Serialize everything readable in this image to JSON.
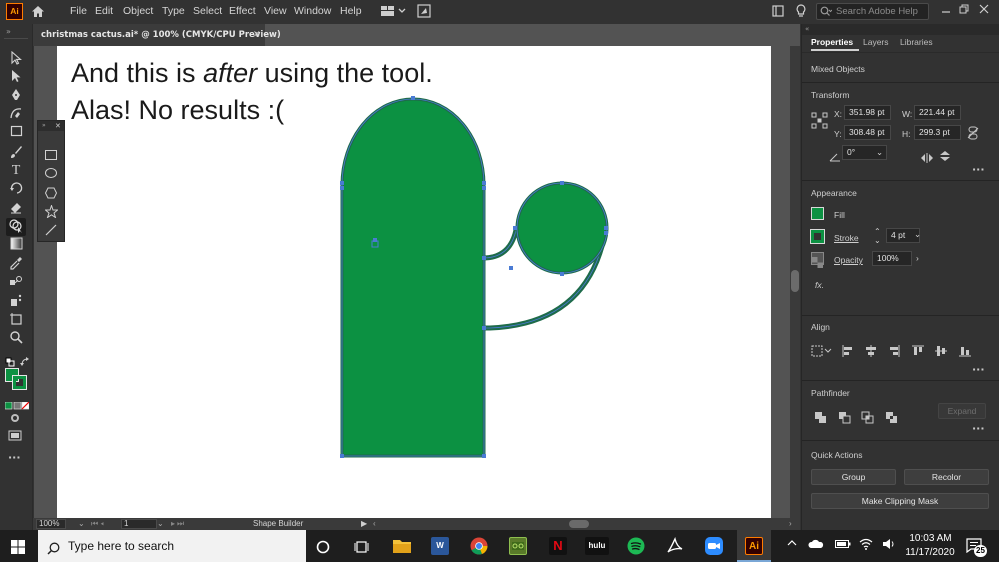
{
  "app": {
    "logo": "Ai",
    "menu": [
      "File",
      "Edit",
      "Object",
      "Type",
      "Select",
      "Effect",
      "View",
      "Window",
      "Help"
    ],
    "search_placeholder": "Search Adobe Help",
    "accent_color": "#ff9a00"
  },
  "document": {
    "tab_title": "christmas cactus.ai* @ 100% (CMYK/CPU Preview)",
    "close_icon": "close-icon"
  },
  "artboard": {
    "line1_pre": "And this is ",
    "line1_em": "after",
    "line1_post": " using the tool.",
    "line2": "Alas! No results :(",
    "fill_color": "#0c9142",
    "stroke_color": "#1e6b4a",
    "selection_color": "#4a7bd4"
  },
  "toolbar": {
    "tools": [
      "selection-tool",
      "direct-selection-tool",
      "pen-tool",
      "curvature-tool",
      "rectangle-tool",
      "paintbrush-tool",
      "type-tool",
      "rotate-tool",
      "eraser-tool",
      "shape-builder-tool",
      "gradient-tool",
      "eyedropper-tool",
      "blend-tool",
      "symbol-sprayer-tool",
      "artboard-tool",
      "zoom-tool"
    ],
    "active_tool": "shape-builder-tool",
    "flyout_tools": [
      "rectangle-tool",
      "ellipse-tool",
      "polygon-tool",
      "star-tool",
      "line-tool"
    ]
  },
  "statusbar": {
    "zoom": "100%",
    "artboard_number": "1",
    "current_tool": "Shape Builder"
  },
  "panel": {
    "tabs": [
      "Properties",
      "Layers",
      "Libraries"
    ],
    "active_tab": "Properties",
    "selection_type": "Mixed Objects",
    "transform": {
      "heading": "Transform",
      "x_label": "X:",
      "x": "351.98 pt",
      "y_label": "Y:",
      "y": "308.48 pt",
      "w_label": "W:",
      "w": "221.44 pt",
      "h_label": "H:",
      "h": "299.3 pt",
      "angle": "0°"
    },
    "appearance": {
      "heading": "Appearance",
      "fill_label": "Fill",
      "stroke_label": "Stroke",
      "stroke_weight": "4 pt",
      "opacity_label": "Opacity",
      "opacity": "100%",
      "fx": "fx."
    },
    "align": {
      "heading": "Align"
    },
    "pathfinder": {
      "heading": "Pathfinder",
      "expand": "Expand"
    },
    "quick_actions": {
      "heading": "Quick Actions",
      "group": "Group",
      "recolor": "Recolor",
      "clipping_mask": "Make Clipping Mask"
    }
  },
  "taskbar": {
    "search_placeholder": "Type here to search",
    "time": "10:03 AM",
    "date": "11/17/2020",
    "notifications": "25",
    "apps": [
      "file-explorer",
      "word",
      "chrome",
      "minecraft",
      "netflix",
      "hulu",
      "spotify",
      "acrobat",
      "zoom",
      "illustrator"
    ],
    "app_labels": {
      "word": "W",
      "netflix": "N",
      "hulu": "hulu",
      "illustrator": "Ai"
    }
  }
}
